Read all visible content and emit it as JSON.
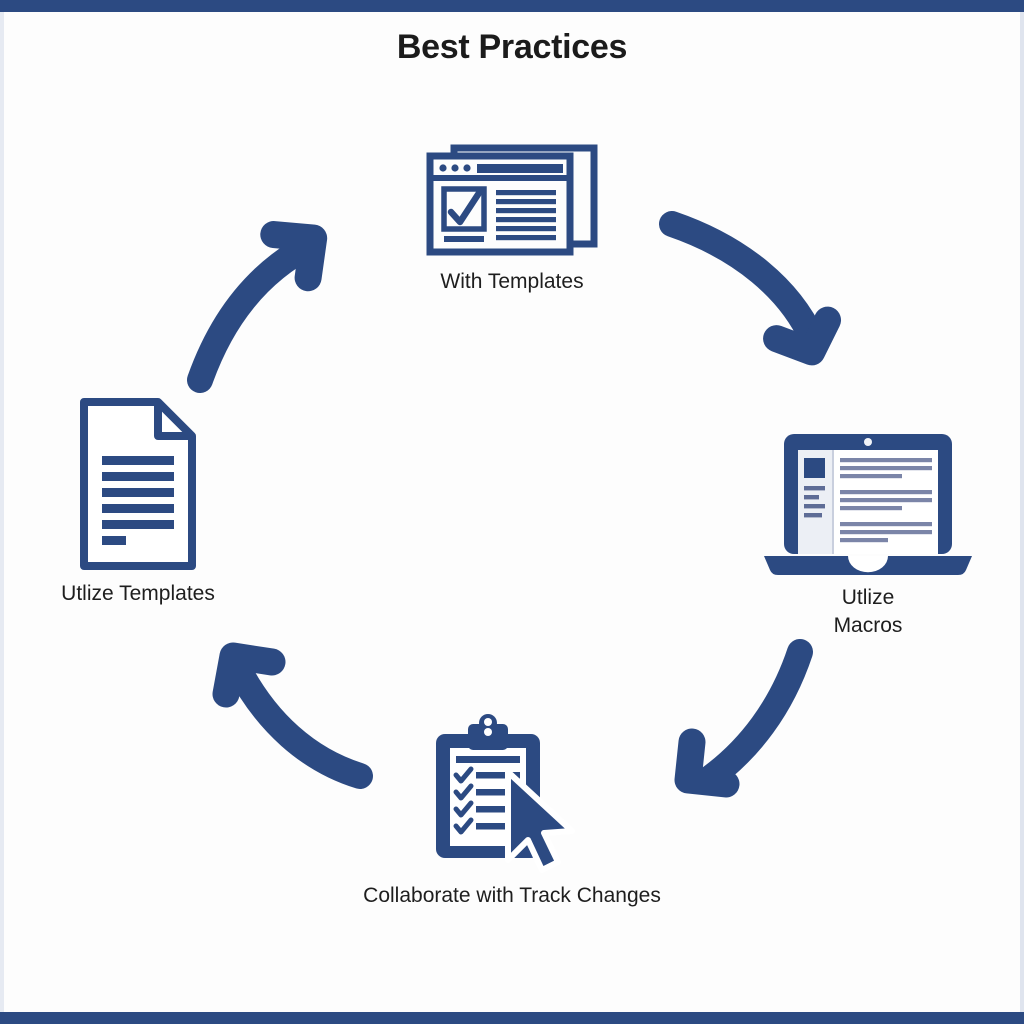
{
  "page": {
    "title": "Best Practices",
    "background_color": "#fdfdfd",
    "accent_color": "#2c4a82",
    "frame_color": "#2c4a82",
    "title_color": "#1b1b1b"
  },
  "diagram": {
    "type": "cycle",
    "direction": "clockwise",
    "node_count": 4,
    "nodes": [
      {
        "id": "with-templates",
        "position": "top",
        "label": "With Templates",
        "icon": "browser-window-checkmark-icon",
        "icon_color": "#2c4a82"
      },
      {
        "id": "utlize-macros",
        "position": "right",
        "label": "Utlize\nMacros",
        "icon": "laptop-document-icon",
        "icon_color": "#2c4a82"
      },
      {
        "id": "collaborate-track-changes",
        "position": "bottom",
        "label": "Collaborate with Track Changes",
        "icon": "clipboard-checklist-cursor-icon",
        "icon_color": "#2c4a82"
      },
      {
        "id": "utlize-templates",
        "position": "left",
        "label": "Utlize Templates",
        "icon": "document-page-icon",
        "icon_color": "#2c4a82"
      }
    ],
    "arrows": [
      {
        "id": "arrow-top-to-right",
        "from": "with-templates",
        "to": "utlize-macros",
        "direction": "down-right",
        "icon": "curved-arrow-icon",
        "color": "#2c4a82"
      },
      {
        "id": "arrow-right-to-bottom",
        "from": "utlize-macros",
        "to": "collaborate-track-changes",
        "direction": "down-left",
        "icon": "curved-arrow-icon",
        "color": "#2c4a82"
      },
      {
        "id": "arrow-bottom-to-left",
        "from": "collaborate-track-changes",
        "to": "utlize-templates",
        "direction": "up-left",
        "icon": "curved-arrow-icon",
        "color": "#2c4a82"
      },
      {
        "id": "arrow-left-to-top",
        "from": "utlize-templates",
        "to": "with-templates",
        "direction": "up-right",
        "icon": "curved-arrow-icon",
        "color": "#2c4a82"
      }
    ]
  }
}
